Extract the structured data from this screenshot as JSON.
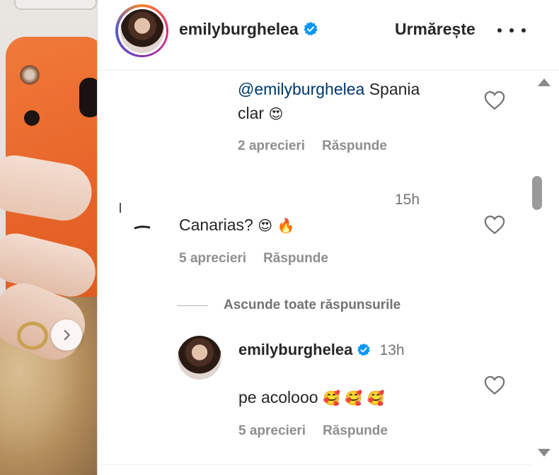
{
  "header": {
    "username": "emilyburghelea",
    "follow_label": "Urmărește",
    "avatar_icon": "profile-photo",
    "verified_icon": "verified-badge-icon",
    "more_icon": "more-options-icon"
  },
  "comments": [
    {
      "mention": "@emilyburghelea",
      "text_line1": " Spania",
      "text_line2": "clar",
      "emoji": "😍",
      "likes_label": "2 aprecieri",
      "reply_label": "Răspunde"
    },
    {
      "time": "15h",
      "text": "Canarias?",
      "emoji1": "😍",
      "emoji2": "🔥",
      "likes_label": "5 aprecieri",
      "reply_label": "Răspunde"
    }
  ],
  "hide_replies_label": "Ascunde toate răspunsurile",
  "reply": {
    "username": "emilyburghelea",
    "time": "13h",
    "text": "pe acolooo",
    "emojis": "🥰 🥰 🥰",
    "likes_label": "5 aprecieri",
    "reply_label": "Răspunde"
  },
  "colors": {
    "text": "#262626",
    "muted": "#8e8e8e",
    "mention": "#00376b",
    "verified": "#0095f6"
  }
}
